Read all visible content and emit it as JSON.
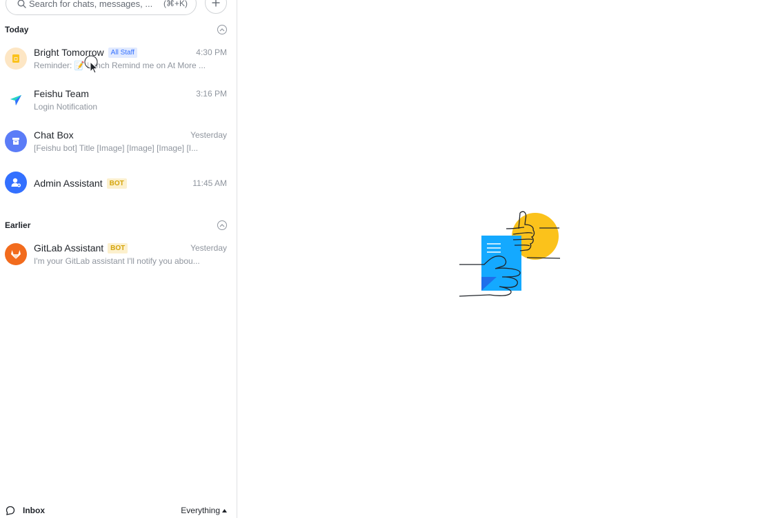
{
  "search": {
    "placeholder": "Search for chats, messages, ...",
    "shortcut": "(⌘+K)",
    "icon": "search-icon"
  },
  "add_button": {
    "icon": "plus-icon"
  },
  "sections": {
    "today": {
      "title": "Today",
      "collapse_icon": "chevron-up-circle-icon"
    },
    "earlier": {
      "title": "Earlier",
      "collapse_icon": "chevron-up-circle-icon"
    }
  },
  "chats": [
    {
      "name": "Bright Tomorrow",
      "tag": "All Staff",
      "time": "4:30 PM",
      "preview": "Reminder: 📝 Lunch Remind me on At More ...",
      "avatar_color": "#fde6c4",
      "icon": "calendar-icon"
    },
    {
      "name": "Feishu Team",
      "time": "3:16 PM",
      "preview": "Login Notification",
      "icon": "paper-plane-icon"
    },
    {
      "name": "Chat Box",
      "time": "Yesterday",
      "preview": "[Feishu bot] Title [Image] [Image] [Image] [I...",
      "avatar_color": "#5b7cf7",
      "icon": "box-icon"
    },
    {
      "name": "Admin Assistant",
      "tag": "BOT",
      "time": "11:45 AM",
      "avatar_color": "#3370ff",
      "icon": "admin-user-icon"
    },
    {
      "name": "GitLab Assistant",
      "tag": "BOT",
      "time": "Yesterday",
      "preview": "I'm your GitLab assistant I'll notify you abou...",
      "avatar_color": "#f26b1d",
      "icon": "gitlab-fox-icon"
    }
  ],
  "footer": {
    "inbox_label": "Inbox",
    "filter_label": "Everything",
    "inbox_icon": "chat-bubble-icon",
    "filter_icon": "caret-up-icon"
  },
  "colors": {
    "accent": "#3370ff",
    "bot_tag": "#fcf0cd",
    "staff_tag": "#e1eaff",
    "illustration_yellow": "#fbc21b",
    "illustration_blue": "#14a9ff"
  }
}
